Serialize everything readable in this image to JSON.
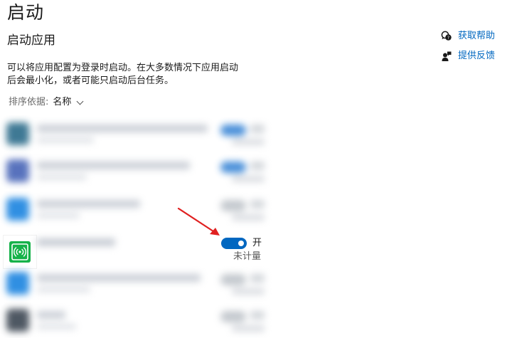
{
  "page": {
    "title": "启动"
  },
  "section": {
    "title": "启动应用",
    "description_line1": "可以将应用配置为登录时启动。在大多数情况下应用启动",
    "description_line2": "后会最小化，或者可能只启动后台任务。"
  },
  "sort": {
    "label": "排序依据:",
    "value": "名称"
  },
  "links": [
    {
      "icon": "help-chat-icon",
      "label": "获取帮助"
    },
    {
      "icon": "feedback-person-icon",
      "label": "提供反馈"
    }
  ],
  "apps": [
    {
      "name": "",
      "blurred": true,
      "icon_color": "#2f6e8c",
      "toggle_on": true
    },
    {
      "name": "",
      "blurred": true,
      "icon_color": "#4a67b8",
      "toggle_on": true
    },
    {
      "name": "",
      "blurred": true,
      "icon_color": "#1f86e0",
      "toggle_on": false
    },
    {
      "name": "",
      "blurred": false,
      "icon": "wifi-signal-app-icon",
      "icon_color": "#16b24a",
      "toggle_on": true,
      "toggle_label": "开",
      "impact": "未计量"
    },
    {
      "name": "",
      "blurred": true,
      "icon_color": "#1f86e0",
      "toggle_on": false
    },
    {
      "name": "",
      "blurred": true,
      "icon_color": "#404a56",
      "toggle_on": false
    }
  ],
  "colors": {
    "accent": "#0067c0",
    "link": "#0067c0",
    "annotation_arrow": "#e02020"
  }
}
